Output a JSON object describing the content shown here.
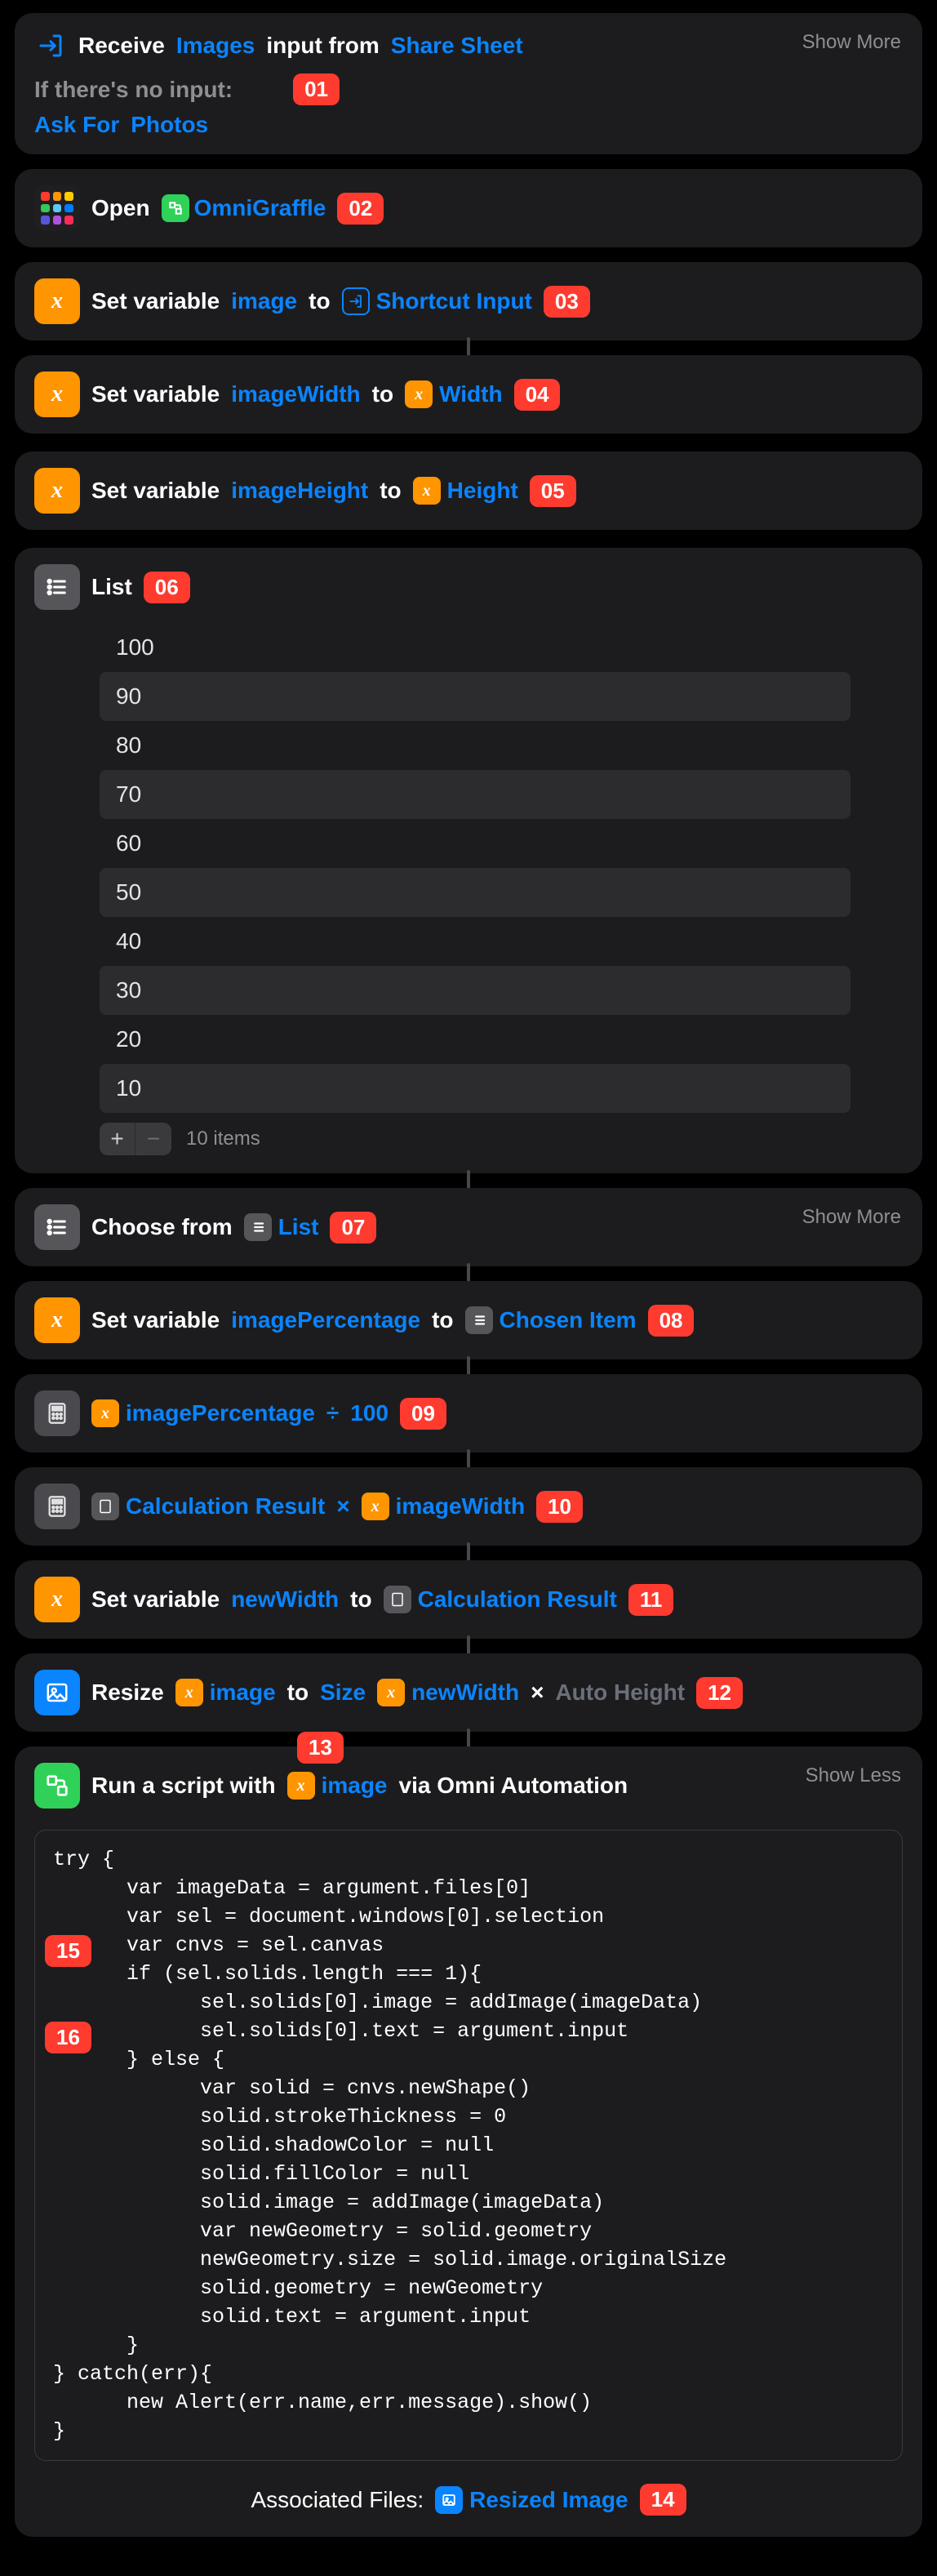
{
  "receive": {
    "prefix": "Receive",
    "type": "Images",
    "mid": "input from",
    "source": "Share Sheet",
    "noInputLabel": "If there's no input:",
    "askFor": "Ask For",
    "photos": "Photos",
    "showMore": "Show More",
    "badge": "01"
  },
  "open": {
    "verb": "Open",
    "app": "OmniGraffle",
    "badge": "02"
  },
  "setVar1": {
    "verb": "Set variable",
    "name": "image",
    "to": "to",
    "valueIcon": "input",
    "value": "Shortcut Input",
    "badge": "03"
  },
  "setVar2": {
    "verb": "Set variable",
    "name": "imageWidth",
    "to": "to",
    "valueIcon": "x",
    "value": "Width",
    "badge": "04"
  },
  "setVar3": {
    "verb": "Set variable",
    "name": "imageHeight",
    "to": "to",
    "valueIcon": "x",
    "value": "Height",
    "badge": "05"
  },
  "list": {
    "title": "List",
    "badge": "06",
    "items": [
      "100",
      "90",
      "80",
      "70",
      "60",
      "50",
      "40",
      "30",
      "20",
      "10"
    ],
    "count": "10 items"
  },
  "choose": {
    "verb": "Choose from",
    "value": "List",
    "badge": "07",
    "showMore": "Show More"
  },
  "setVar4": {
    "verb": "Set variable",
    "name": "imagePercentage",
    "to": "to",
    "valueIcon": "list",
    "value": "Chosen Item",
    "badge": "08"
  },
  "calc1": {
    "a": "imagePercentage",
    "op": "÷",
    "b": "100",
    "badge": "09"
  },
  "calc2": {
    "aIcon": "calc",
    "a": "Calculation Result",
    "op": "×",
    "bIcon": "x",
    "b": "imageWidth",
    "badge": "10"
  },
  "setVar5": {
    "verb": "Set variable",
    "name": "newWidth",
    "to": "to",
    "valueIcon": "calc",
    "value": "Calculation Result",
    "badge": "11"
  },
  "resize": {
    "verb": "Resize",
    "img": "image",
    "to": "to",
    "sizeWord": "Size",
    "w": "newWidth",
    "times": "×",
    "h": "Auto Height",
    "badge": "12"
  },
  "script": {
    "verb": "Run a script with",
    "arg": "image",
    "via": "via Omni Automation",
    "showLess": "Show Less",
    "badgeTop": "13",
    "badge15": "15",
    "badge16": "16",
    "code": "try {\n      var imageData = argument.files[0]\n      var sel = document.windows[0].selection\n      var cnvs = sel.canvas\n      if (sel.solids.length === 1){\n            sel.solids[0].image = addImage(imageData)\n            sel.solids[0].text = argument.input\n      } else {\n            var solid = cnvs.newShape()\n            solid.strokeThickness = 0\n            solid.shadowColor = null\n            solid.fillColor = null\n            solid.image = addImage(imageData)\n            var newGeometry = solid.geometry\n            newGeometry.size = solid.image.originalSize\n            solid.geometry = newGeometry\n            solid.text = argument.input\n      }\n} catch(err){\n      new Alert(err.name,err.message).show()\n}",
    "assocLabel": "Associated Files:",
    "assocValue": "Resized Image",
    "badgeAssoc": "14"
  }
}
